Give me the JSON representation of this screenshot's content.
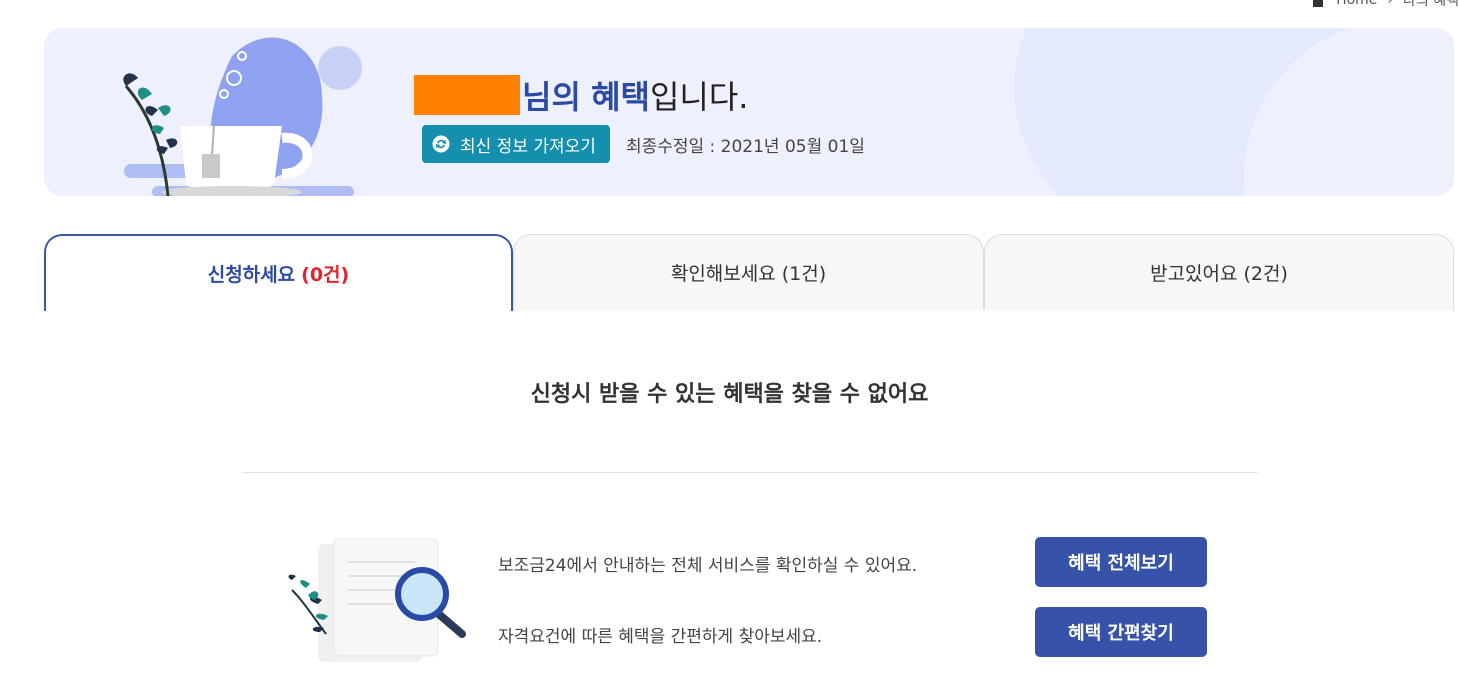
{
  "breadcrumb": {
    "home": "Home",
    "current": "나의 혜택"
  },
  "hero": {
    "greeting_suffix": "님의",
    "greeting_emph": "혜택",
    "greeting_end": "입니다.",
    "refresh_label": "최신 정보 가져오기",
    "modified_date": "최종수정일 : 2021년 05월 01일"
  },
  "tabs": [
    {
      "label": "신청하세요",
      "count": "(0건)"
    },
    {
      "label": "확인해보세요",
      "count": "(1건)"
    },
    {
      "label": "받고있어요",
      "count": "(2건)"
    }
  ],
  "main": {
    "empty_message": "신청시 받을 수 있는 혜택을 찾을 수 없어요",
    "info1": "보조금24에서 안내하는 전체 서비스를 확인하실 수 있어요.",
    "info2": "자격요건에 따른 혜택을 간편하게 찾아보세요.",
    "btn_all": "혜택 전체보기",
    "btn_find": "혜택 간편찾기"
  },
  "colors": {
    "accent": "#3653a9",
    "teal": "#158fae",
    "red": "#e0242b",
    "redact": "#ff7f00"
  }
}
